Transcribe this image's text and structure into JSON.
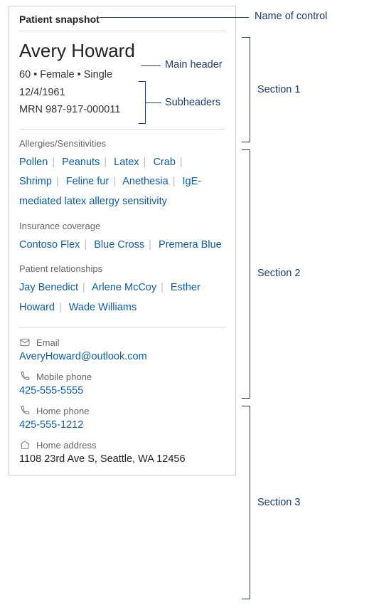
{
  "card_title": "Patient snapshot",
  "header": {
    "name": "Avery Howard",
    "sub1": "60 • Female • Single",
    "sub2": "12/4/1961",
    "sub3": "MRN 987-917-000011"
  },
  "section2": {
    "allergies_label": "Allergies/Sensitivities",
    "allergies": [
      "Pollen",
      "Peanuts",
      "Latex",
      "Crab",
      "Shrimp",
      "Feline fur",
      "Anethesia",
      "IgE-mediated latex allergy sensitivity"
    ],
    "insurance_label": "Insurance coverage",
    "insurance": [
      "Contoso Flex",
      "Blue Cross",
      "Premera Blue"
    ],
    "relationships_label": "Patient relationships",
    "relationships": [
      "Jay Benedict",
      "Arlene McCoy",
      "Esther Howard",
      "Wade Williams"
    ]
  },
  "section3": {
    "email_label": "Email",
    "email_value": "AveryHoward@outlook.com",
    "mobile_label": "Mobile phone",
    "mobile_value": "425-555-5555",
    "home_phone_label": "Home phone",
    "home_phone_value": "425-555-1212",
    "address_label": "Home address",
    "address_value": "1108 23rd Ave S, Seattle, WA 12456"
  },
  "annotations": {
    "name_of_control": "Name of control",
    "main_header": "Main header",
    "subheaders": "Subheaders",
    "section1": "Section 1",
    "section2": "Section 2",
    "section3": "Section 3"
  }
}
